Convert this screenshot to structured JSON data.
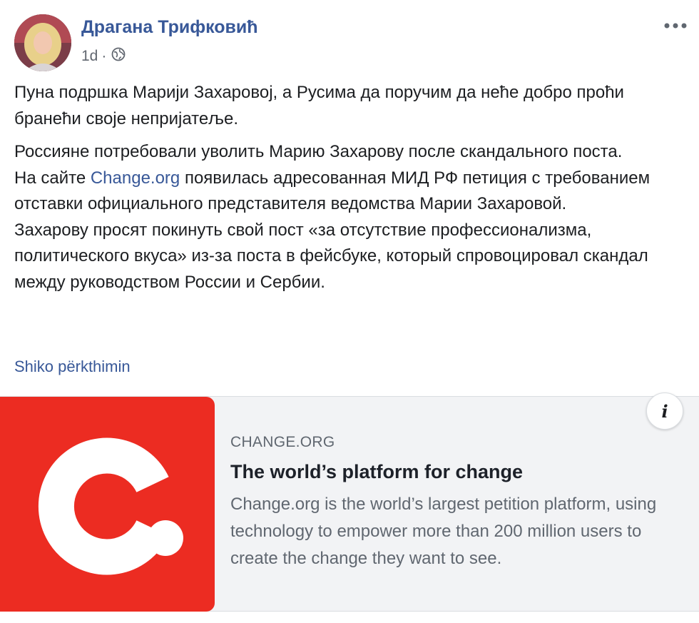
{
  "post": {
    "author": "Драгана Трифковић",
    "timestamp": "1d",
    "separator": "·",
    "privacy_icon": "globe-icon",
    "more_icon": "more-horizontal-icon",
    "text_serbian": "Пуна подршка Марији Захаровој, а Русима да поручим да неће добро проћи бранећи своје непријатеље.",
    "text_russian": {
      "line1": "Россияне потребовали уволить Марию Захарову после скандального поста.",
      "line2_before": "На сайте ",
      "line2_link": "Change.org",
      "line2_after": " появилась адресованная МИД РФ петиция с требованием отставки официального представителя ведомства Марии Захаровой.",
      "line3": "Захарову просят покинуть свой пост «за отсутствие профессионализма, политического вкуса» из-за поста в фейсбуке, который спровоцировал скандал между руководством России и Сербии."
    },
    "see_translation": "Shiko përkthimin"
  },
  "link_card": {
    "domain": "CHANGE.ORG",
    "title": "The world’s platform for change",
    "description": "Change.org is the world’s largest petition platform, using technology to empower more than 200 million users to create the change they want to see.",
    "info_label": "i",
    "logo_color": "#ec2c22"
  },
  "colors": {
    "link": "#385898",
    "text": "#1c1e21",
    "muted": "#606770",
    "card_bg": "#f2f3f5"
  }
}
